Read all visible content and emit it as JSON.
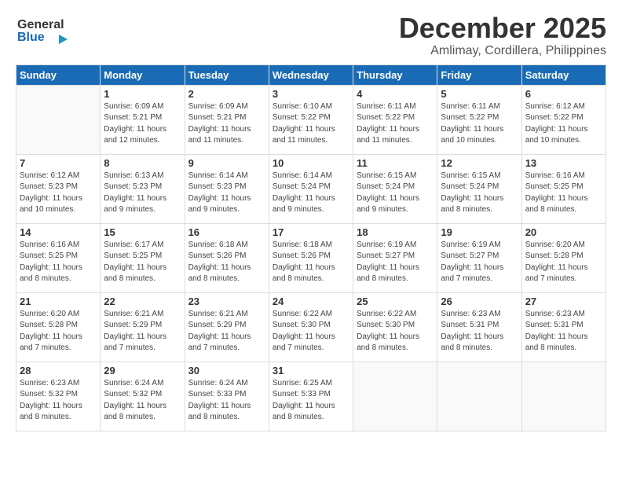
{
  "header": {
    "logo_general": "General",
    "logo_blue": "Blue",
    "title": "December 2025",
    "subtitle": "Amlimay, Cordillera, Philippines"
  },
  "weekdays": [
    "Sunday",
    "Monday",
    "Tuesday",
    "Wednesday",
    "Thursday",
    "Friday",
    "Saturday"
  ],
  "weeks": [
    [
      {
        "day": "",
        "sunrise": "",
        "sunset": "",
        "daylight": ""
      },
      {
        "day": "1",
        "sunrise": "6:09 AM",
        "sunset": "5:21 PM",
        "daylight": "11 hours and 12 minutes."
      },
      {
        "day": "2",
        "sunrise": "6:09 AM",
        "sunset": "5:21 PM",
        "daylight": "11 hours and 11 minutes."
      },
      {
        "day": "3",
        "sunrise": "6:10 AM",
        "sunset": "5:22 PM",
        "daylight": "11 hours and 11 minutes."
      },
      {
        "day": "4",
        "sunrise": "6:11 AM",
        "sunset": "5:22 PM",
        "daylight": "11 hours and 11 minutes."
      },
      {
        "day": "5",
        "sunrise": "6:11 AM",
        "sunset": "5:22 PM",
        "daylight": "11 hours and 10 minutes."
      },
      {
        "day": "6",
        "sunrise": "6:12 AM",
        "sunset": "5:22 PM",
        "daylight": "11 hours and 10 minutes."
      }
    ],
    [
      {
        "day": "7",
        "sunrise": "6:12 AM",
        "sunset": "5:23 PM",
        "daylight": "11 hours and 10 minutes."
      },
      {
        "day": "8",
        "sunrise": "6:13 AM",
        "sunset": "5:23 PM",
        "daylight": "11 hours and 9 minutes."
      },
      {
        "day": "9",
        "sunrise": "6:14 AM",
        "sunset": "5:23 PM",
        "daylight": "11 hours and 9 minutes."
      },
      {
        "day": "10",
        "sunrise": "6:14 AM",
        "sunset": "5:24 PM",
        "daylight": "11 hours and 9 minutes."
      },
      {
        "day": "11",
        "sunrise": "6:15 AM",
        "sunset": "5:24 PM",
        "daylight": "11 hours and 9 minutes."
      },
      {
        "day": "12",
        "sunrise": "6:15 AM",
        "sunset": "5:24 PM",
        "daylight": "11 hours and 8 minutes."
      },
      {
        "day": "13",
        "sunrise": "6:16 AM",
        "sunset": "5:25 PM",
        "daylight": "11 hours and 8 minutes."
      }
    ],
    [
      {
        "day": "14",
        "sunrise": "6:16 AM",
        "sunset": "5:25 PM",
        "daylight": "11 hours and 8 minutes."
      },
      {
        "day": "15",
        "sunrise": "6:17 AM",
        "sunset": "5:25 PM",
        "daylight": "11 hours and 8 minutes."
      },
      {
        "day": "16",
        "sunrise": "6:18 AM",
        "sunset": "5:26 PM",
        "daylight": "11 hours and 8 minutes."
      },
      {
        "day": "17",
        "sunrise": "6:18 AM",
        "sunset": "5:26 PM",
        "daylight": "11 hours and 8 minutes."
      },
      {
        "day": "18",
        "sunrise": "6:19 AM",
        "sunset": "5:27 PM",
        "daylight": "11 hours and 8 minutes."
      },
      {
        "day": "19",
        "sunrise": "6:19 AM",
        "sunset": "5:27 PM",
        "daylight": "11 hours and 7 minutes."
      },
      {
        "day": "20",
        "sunrise": "6:20 AM",
        "sunset": "5:28 PM",
        "daylight": "11 hours and 7 minutes."
      }
    ],
    [
      {
        "day": "21",
        "sunrise": "6:20 AM",
        "sunset": "5:28 PM",
        "daylight": "11 hours and 7 minutes."
      },
      {
        "day": "22",
        "sunrise": "6:21 AM",
        "sunset": "5:29 PM",
        "daylight": "11 hours and 7 minutes."
      },
      {
        "day": "23",
        "sunrise": "6:21 AM",
        "sunset": "5:29 PM",
        "daylight": "11 hours and 7 minutes."
      },
      {
        "day": "24",
        "sunrise": "6:22 AM",
        "sunset": "5:30 PM",
        "daylight": "11 hours and 7 minutes."
      },
      {
        "day": "25",
        "sunrise": "6:22 AM",
        "sunset": "5:30 PM",
        "daylight": "11 hours and 8 minutes."
      },
      {
        "day": "26",
        "sunrise": "6:23 AM",
        "sunset": "5:31 PM",
        "daylight": "11 hours and 8 minutes."
      },
      {
        "day": "27",
        "sunrise": "6:23 AM",
        "sunset": "5:31 PM",
        "daylight": "11 hours and 8 minutes."
      }
    ],
    [
      {
        "day": "28",
        "sunrise": "6:23 AM",
        "sunset": "5:32 PM",
        "daylight": "11 hours and 8 minutes."
      },
      {
        "day": "29",
        "sunrise": "6:24 AM",
        "sunset": "5:32 PM",
        "daylight": "11 hours and 8 minutes."
      },
      {
        "day": "30",
        "sunrise": "6:24 AM",
        "sunset": "5:33 PM",
        "daylight": "11 hours and 8 minutes."
      },
      {
        "day": "31",
        "sunrise": "6:25 AM",
        "sunset": "5:33 PM",
        "daylight": "11 hours and 8 minutes."
      },
      {
        "day": "",
        "sunrise": "",
        "sunset": "",
        "daylight": ""
      },
      {
        "day": "",
        "sunrise": "",
        "sunset": "",
        "daylight": ""
      },
      {
        "day": "",
        "sunrise": "",
        "sunset": "",
        "daylight": ""
      }
    ]
  ]
}
